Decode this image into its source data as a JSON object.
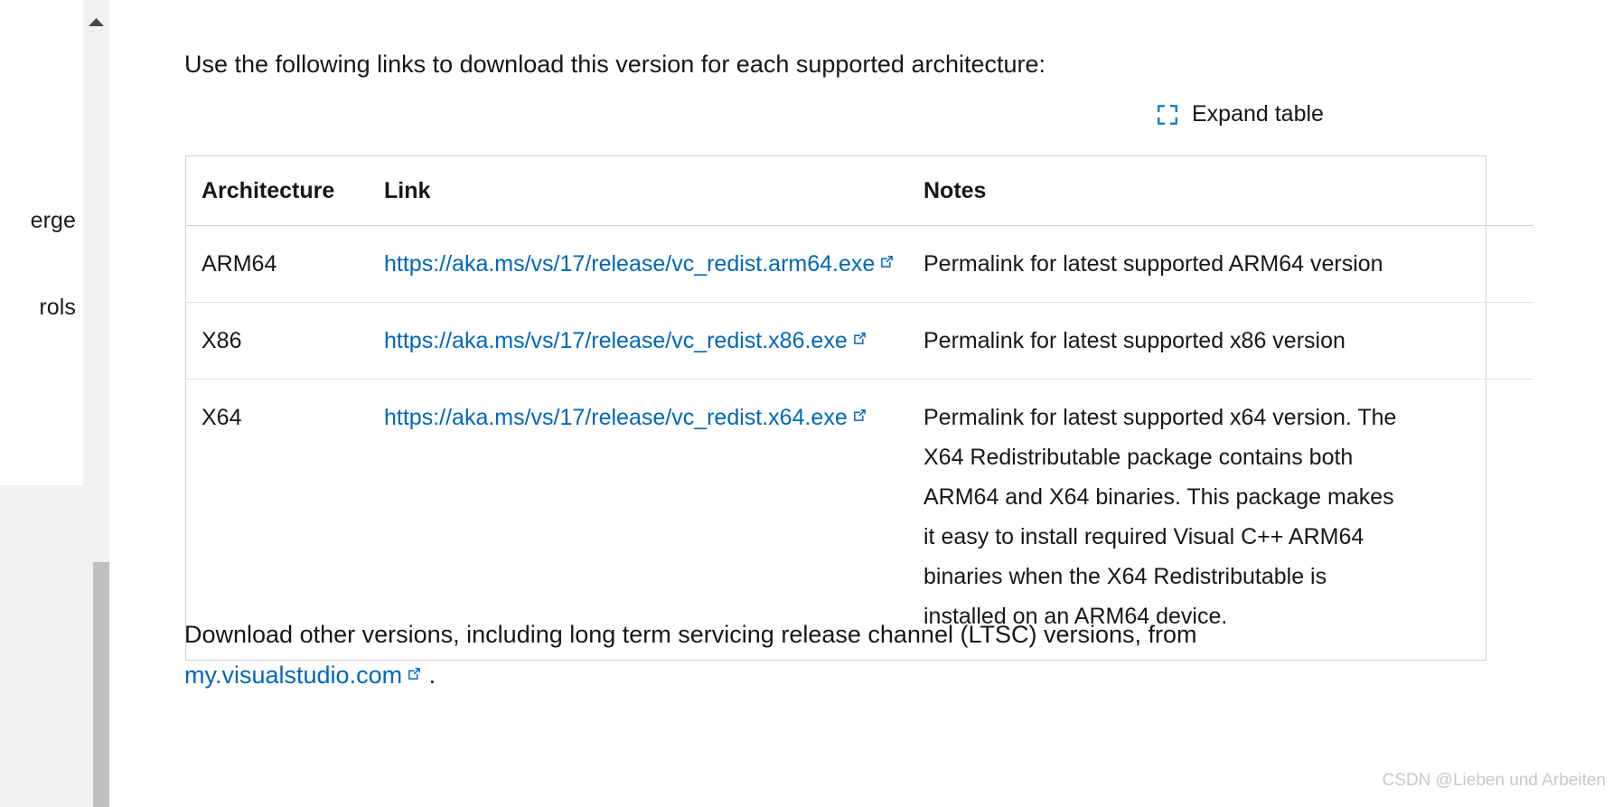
{
  "sidebar": {
    "nav_fragments": [
      "erge",
      "rols"
    ]
  },
  "scrollbar": {
    "up_arrow_icon": "chevron-up-icon"
  },
  "article": {
    "intro_paragraph": "Use the following links to download this version for each supported architecture:",
    "expand_table": {
      "label": "Expand table",
      "icon": "expand-icon",
      "icon_color": "#0078d4"
    },
    "table": {
      "columns": [
        "Architecture",
        "Link",
        "Notes"
      ],
      "rows": [
        {
          "architecture": "ARM64",
          "link_text": "https://aka.ms/vs/17/release/vc_redist.arm64.exe",
          "link_icon": "external-link-icon",
          "notes": "Permalink for latest supported ARM64 version"
        },
        {
          "architecture": "X86",
          "link_text": "https://aka.ms/vs/17/release/vc_redist.x86.exe",
          "link_icon": "external-link-icon",
          "notes": "Permalink for latest supported x86 version"
        },
        {
          "architecture": "X64",
          "link_text": "https://aka.ms/vs/17/release/vc_redist.x64.exe",
          "link_icon": "external-link-icon",
          "notes": "Permalink for latest supported x64 version. The X64 Redistributable package contains both ARM64 and X64 binaries. This package makes it easy to install required Visual C++ ARM64 binaries when the X64 Redistributable is installed on an ARM64 device."
        }
      ]
    },
    "outro": {
      "lead_text": "Download other versions, including long term servicing release channel (LTSC) versions, from ",
      "link_text": "my.visualstudio.com",
      "link_icon": "external-link-icon",
      "trailing_text": " ."
    }
  },
  "watermark": "CSDN @Lieben und Arbeiten",
  "colors": {
    "link": "#0067b8",
    "accent": "#0078d4",
    "text": "#171717",
    "table_border": "#d2d2d2",
    "row_border": "#e1e1e1",
    "scroll_track": "#f1f1f1",
    "scroll_thumb": "#c0c0c0"
  }
}
